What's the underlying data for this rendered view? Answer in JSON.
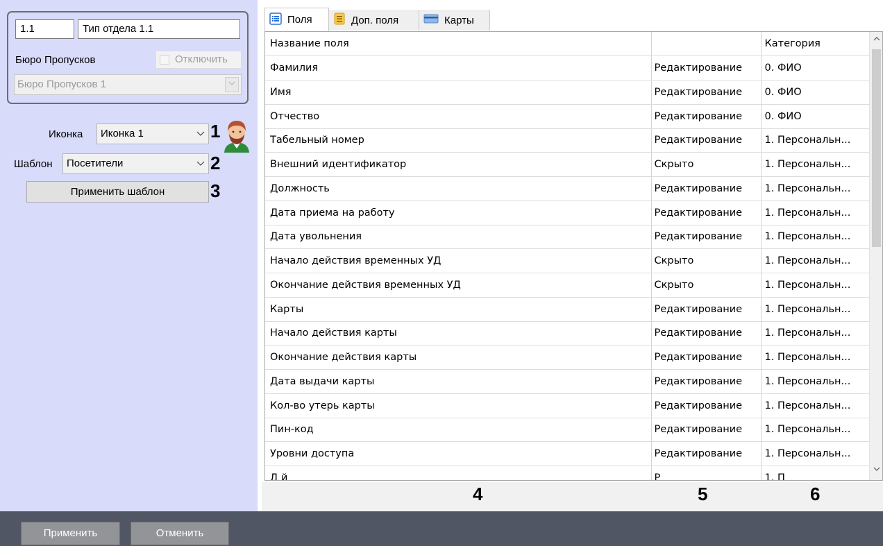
{
  "left_panel": {
    "code_value": "1.1",
    "name_value": "Тип отдела 1.1",
    "bureau_label": "Бюро Пропусков",
    "disable_label": "Отключить",
    "bureau_value": "Бюро Пропусков 1",
    "icon_label": "Иконка",
    "icon_value": "Иконка 1",
    "template_label": "Шаблон",
    "template_value": "Посетители",
    "apply_template_label": "Применить шаблон",
    "callouts": [
      "1",
      "2",
      "3"
    ]
  },
  "tabs": [
    {
      "label": "Поля",
      "icon": "list-icon",
      "active": true
    },
    {
      "label": "Доп. поля",
      "icon": "notes-icon",
      "active": false
    },
    {
      "label": "Карты",
      "icon": "card-icon",
      "active": false
    }
  ],
  "table": {
    "headers": [
      "Название поля",
      "",
      "Категория"
    ],
    "rows": [
      [
        "Фамилия",
        "Редактирование",
        "0. ФИО"
      ],
      [
        "Имя",
        "Редактирование",
        "0. ФИО"
      ],
      [
        "Отчество",
        "Редактирование",
        "0. ФИО"
      ],
      [
        "Табельный номер",
        "Редактирование",
        "1. Персональн..."
      ],
      [
        "Внешний идентификатор",
        "Скрыто",
        "1. Персональн..."
      ],
      [
        "Должность",
        "Редактирование",
        "1. Персональн..."
      ],
      [
        "Дата приема на работу",
        "Редактирование",
        "1. Персональн..."
      ],
      [
        "Дата увольнения",
        "Редактирование",
        "1. Персональн..."
      ],
      [
        "Начало действия временных УД",
        "Скрыто",
        "1. Персональн..."
      ],
      [
        "Окончание действия временных УД",
        "Скрыто",
        "1. Персональн..."
      ],
      [
        "Карты",
        "Редактирование",
        "1. Персональн..."
      ],
      [
        "Начало действия карты",
        "Редактирование",
        "1. Персональн..."
      ],
      [
        "Окончание действия карты",
        "Редактирование",
        "1. Персональн..."
      ],
      [
        "Дата выдачи карты",
        "Редактирование",
        "1. Персональн..."
      ],
      [
        "Кол-во утерь карты",
        "Редактирование",
        "1. Персональн..."
      ],
      [
        "Пин-код",
        "Редактирование",
        "1. Персональн..."
      ],
      [
        "Уровни доступа",
        "Редактирование",
        "1. Персональн..."
      ],
      [
        "Д    й",
        "Р",
        "1. П"
      ]
    ]
  },
  "column_callouts": [
    "4",
    "5",
    "6"
  ],
  "bottom_bar": {
    "apply_label": "Применить",
    "cancel_label": "Отменить"
  },
  "colors": {
    "panel_bg": "#d8dbfa",
    "bottom_bar_bg": "#515664",
    "bottom_button_bg": "#939497"
  }
}
